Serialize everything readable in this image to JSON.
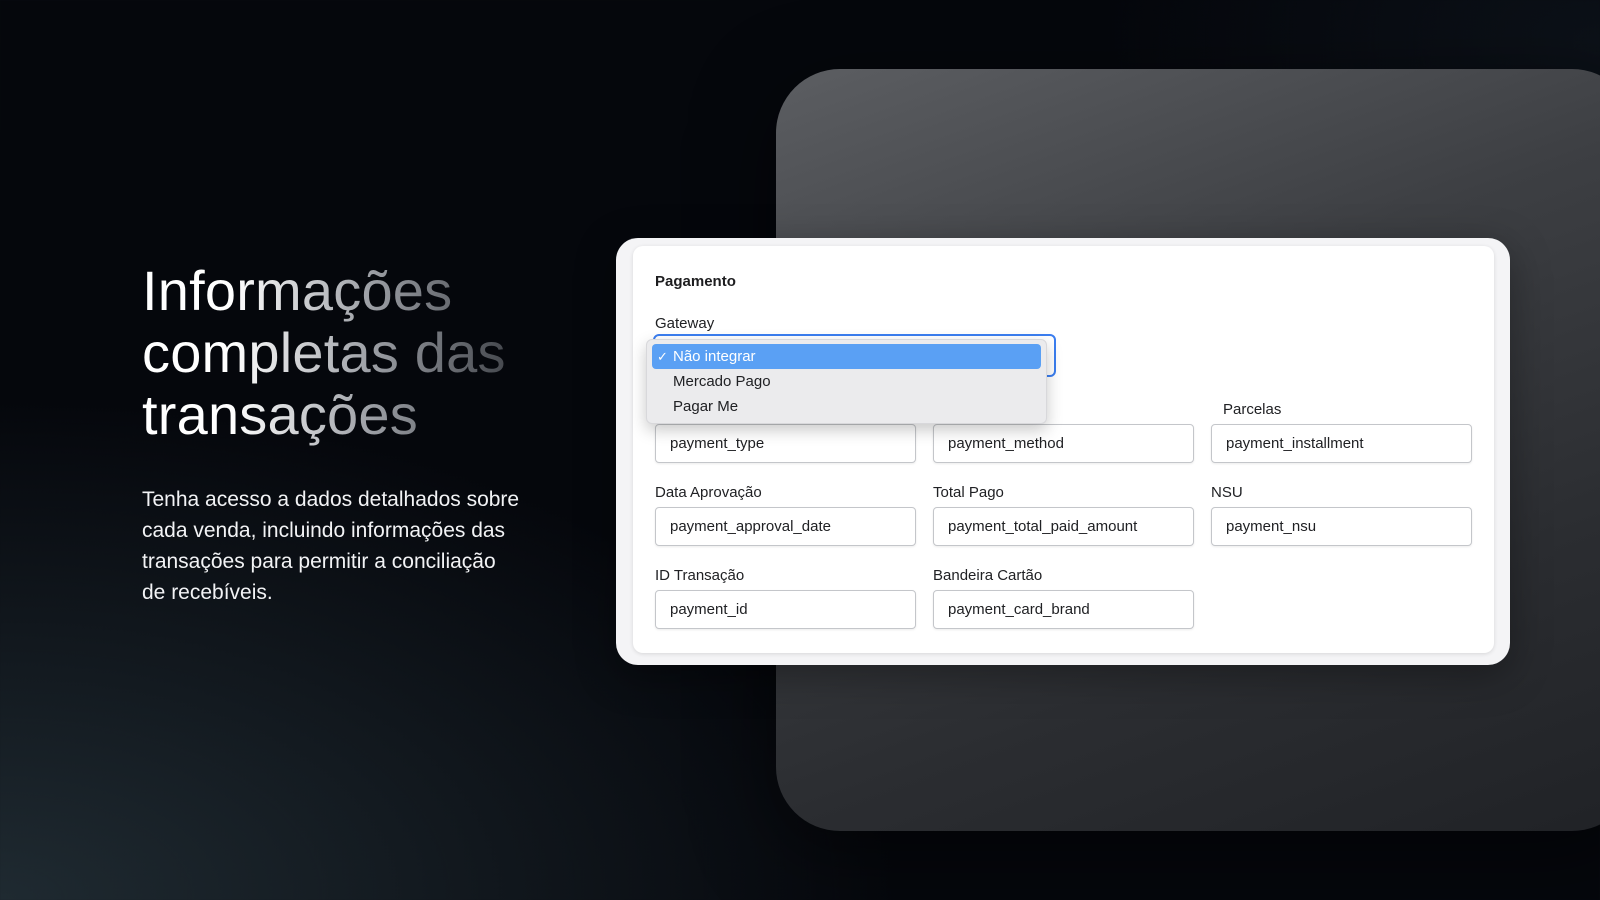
{
  "hero": {
    "title_lines": [
      "Informações",
      "completas das",
      "transações"
    ],
    "description": "Tenha acesso a dados detalhados sobre cada venda, incluindo informações das transações para permitir a conciliação de recebíveis."
  },
  "form": {
    "section_title": "Pagamento",
    "gateway": {
      "label": "Gateway",
      "selected": "Não integrar",
      "options": [
        "Não integrar",
        "Mercado Pago",
        "Pagar Me"
      ],
      "check_glyph": "✓"
    },
    "fields": {
      "payment_type": {
        "value": "payment_type"
      },
      "payment_method": {
        "value": "payment_method"
      },
      "installments": {
        "label": "Parcelas",
        "value": "payment_installment"
      },
      "approval_date": {
        "label": "Data Aprovação",
        "value": "payment_approval_date"
      },
      "total_paid": {
        "label": "Total Pago",
        "value": "payment_total_paid_amount"
      },
      "nsu": {
        "label": "NSU",
        "value": "payment_nsu"
      },
      "transaction_id": {
        "label": "ID Transação",
        "value": "payment_id"
      },
      "card_brand": {
        "label": "Bandeira Cartão",
        "value": "payment_card_brand"
      }
    }
  },
  "colors": {
    "focus_ring": "#3b7ef0",
    "selected_option": "#5aa0f4",
    "page_background": "#05070c"
  }
}
